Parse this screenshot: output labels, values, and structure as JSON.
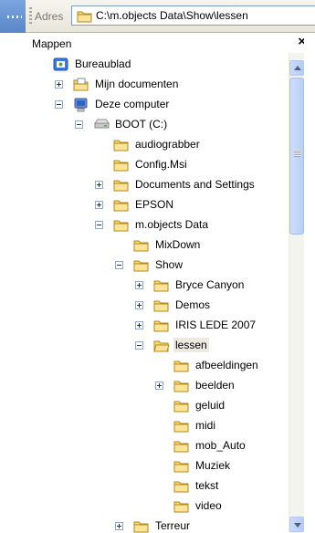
{
  "address_bar": {
    "label": "Adres",
    "path": "C:\\m.objects Data\\Show\\lessen"
  },
  "pane": {
    "title": "Mappen",
    "close": "×"
  },
  "tree": {
    "items": [
      {
        "label": "Bureaublad",
        "icon": "desktop-icon"
      },
      {
        "label": "Mijn documenten",
        "icon": "documents-folder-icon",
        "expander": "plus"
      },
      {
        "label": "Deze computer",
        "icon": "computer-icon",
        "expander": "minus"
      },
      {
        "label": "BOOT (C:)",
        "icon": "drive-icon",
        "expander": "minus"
      },
      {
        "label": "audiograbber",
        "icon": "folder-icon"
      },
      {
        "label": "Config.Msi",
        "icon": "folder-icon"
      },
      {
        "label": "Documents and Settings",
        "icon": "folder-icon",
        "expander": "plus"
      },
      {
        "label": "EPSON",
        "icon": "folder-icon",
        "expander": "plus"
      },
      {
        "label": "m.objects Data",
        "icon": "folder-icon",
        "expander": "minus"
      },
      {
        "label": "MixDown",
        "icon": "folder-icon"
      },
      {
        "label": "Show",
        "icon": "folder-icon",
        "expander": "minus"
      },
      {
        "label": "Bryce Canyon",
        "icon": "folder-icon",
        "expander": "plus"
      },
      {
        "label": "Demos",
        "icon": "folder-icon",
        "expander": "plus"
      },
      {
        "label": "IRIS LEDE 2007",
        "icon": "folder-icon",
        "expander": "plus"
      },
      {
        "label": "lessen",
        "icon": "folder-open-icon",
        "expander": "minus",
        "selected": true
      },
      {
        "label": "afbeeldingen",
        "icon": "folder-icon"
      },
      {
        "label": "beelden",
        "icon": "folder-icon",
        "expander": "plus"
      },
      {
        "label": "geluid",
        "icon": "folder-icon"
      },
      {
        "label": "midi",
        "icon": "folder-icon"
      },
      {
        "label": "mob_Auto",
        "icon": "folder-icon"
      },
      {
        "label": "Muziek",
        "icon": "folder-icon"
      },
      {
        "label": "tekst",
        "icon": "folder-icon"
      },
      {
        "label": "video",
        "icon": "folder-icon"
      },
      {
        "label": "Terreur",
        "icon": "folder-icon",
        "expander": "plus"
      }
    ]
  },
  "colors": {
    "selection": "#ebe9e2",
    "folder": "#f5d774",
    "scrollbar": "#c1d3fb"
  }
}
